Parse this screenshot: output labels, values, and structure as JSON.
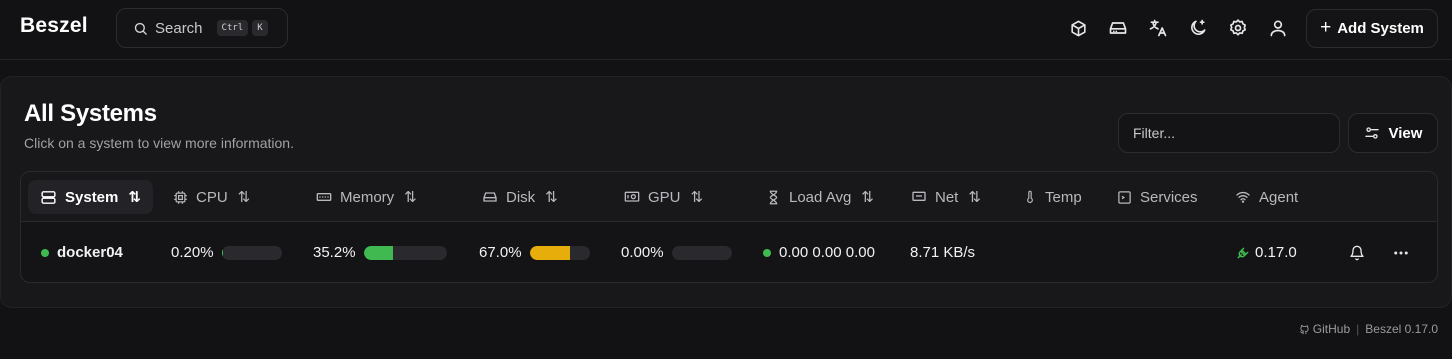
{
  "app": {
    "name": "Beszel"
  },
  "search": {
    "label": "Search",
    "kbd1": "Ctrl",
    "kbd2": "K"
  },
  "header_icons": [
    "box-icon",
    "drive-icon",
    "translate-icon",
    "theme-toggle-icon",
    "settings-icon",
    "user-icon"
  ],
  "add_button": {
    "label": "Add System"
  },
  "page": {
    "title": "All Systems",
    "subtitle": "Click on a system to view more information."
  },
  "filter": {
    "placeholder": "Filter..."
  },
  "view_button": {
    "label": "View"
  },
  "table": {
    "columns": [
      "System",
      "CPU",
      "Memory",
      "Disk",
      "GPU",
      "Load Avg",
      "Net",
      "Temp",
      "Services",
      "Agent"
    ],
    "rows": [
      {
        "system": "docker04",
        "status": "up",
        "cpu": "0.20%",
        "cpu_frac": 0.002,
        "memory": "35.2%",
        "memory_frac": 0.352,
        "disk": "67.0%",
        "disk_frac": 0.67,
        "gpu": "0.00%",
        "gpu_frac": 0.0,
        "load_avg": "0.00 0.00 0.00",
        "net": "8.71 KB/s",
        "temp": "",
        "services": "",
        "agent": "0.17.0"
      }
    ]
  },
  "colors": {
    "accent_green": "#3fb950",
    "memory_bar": "#3fb950",
    "disk_bar": "#e6ad0b",
    "background": "#121214"
  },
  "footer": {
    "github": "GitHub",
    "version": "Beszel 0.17.0"
  }
}
